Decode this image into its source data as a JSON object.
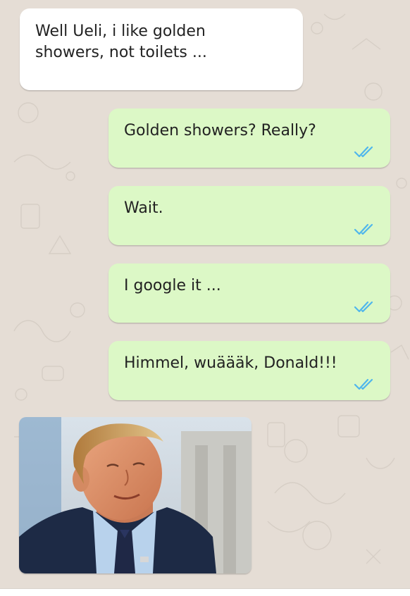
{
  "colors": {
    "chat_background": "#e5ddd5",
    "incoming_bubble": "#ffffff",
    "outgoing_bubble": "#dcf8c6",
    "read_ticks": "#4fb6ec"
  },
  "messages": [
    {
      "direction": "incoming",
      "text": "Well Ueli, i like golden\nshowers, not toilets ..."
    },
    {
      "direction": "outgoing",
      "text": "Golden showers? Really?",
      "status_icon": "double-check-read-icon"
    },
    {
      "direction": "outgoing",
      "text": "Wait.",
      "status_icon": "double-check-read-icon"
    },
    {
      "direction": "outgoing",
      "text": "I google it ...",
      "status_icon": "double-check-read-icon"
    },
    {
      "direction": "outgoing",
      "text": "Himmel, wuäääk, Donald!!!",
      "status_icon": "double-check-read-icon"
    }
  ],
  "image_message": {
    "direction": "incoming",
    "content": "photo"
  }
}
